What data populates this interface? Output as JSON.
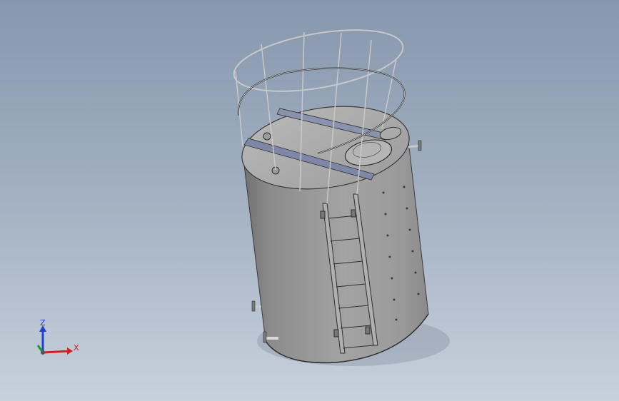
{
  "viewport": {
    "background_top": "#8797ad",
    "background_bottom": "#c7d1dc"
  },
  "model": {
    "shell_color": "#9a9a9a",
    "top_color": "#a8a8a8",
    "edge_color": "#3a3a3a",
    "rail_color": "#c8c8c8"
  },
  "triad": {
    "x_label": "X",
    "z_label": "Z",
    "x_color": "#d42020",
    "y_color": "#1e9a2e",
    "z_color": "#2040d0"
  }
}
